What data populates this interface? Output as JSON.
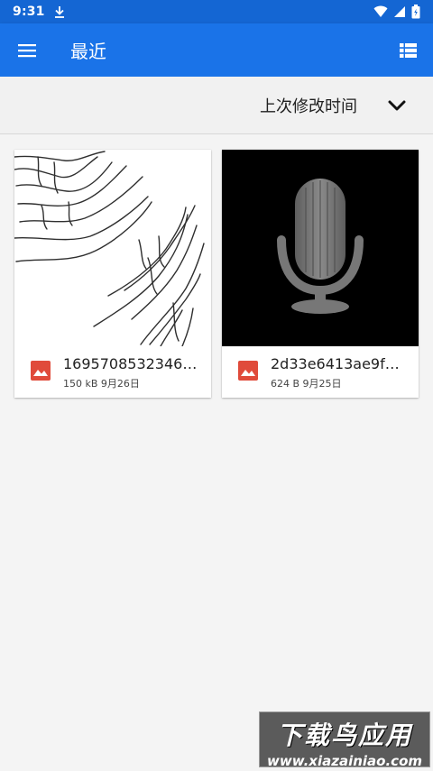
{
  "status_bar": {
    "time": "9:31",
    "icons": [
      "download-icon",
      "wifi-icon",
      "signal-icon",
      "battery-icon"
    ]
  },
  "app_bar": {
    "title": "最近",
    "color": "#1a73e8",
    "icons": [
      "menu-icon",
      "list-view-icon"
    ]
  },
  "sort": {
    "label": "上次修改时间",
    "icon": "chevron-down-icon"
  },
  "files": [
    {
      "name": "1695708532346.j...",
      "size": "150 kB",
      "date": "9月26日",
      "icon": "image-file-icon",
      "icon_color": "#e04b3b",
      "thumbnail": "handwriting-sketch"
    },
    {
      "name": "2d33e6413ae9f0d...",
      "size": "624 B",
      "date": "9月25日",
      "icon": "image-file-icon",
      "icon_color": "#e04b3b",
      "thumbnail": "microphone"
    }
  ],
  "watermark": {
    "text": "下载鸟应用",
    "url": "www.xiazainiao.com"
  }
}
